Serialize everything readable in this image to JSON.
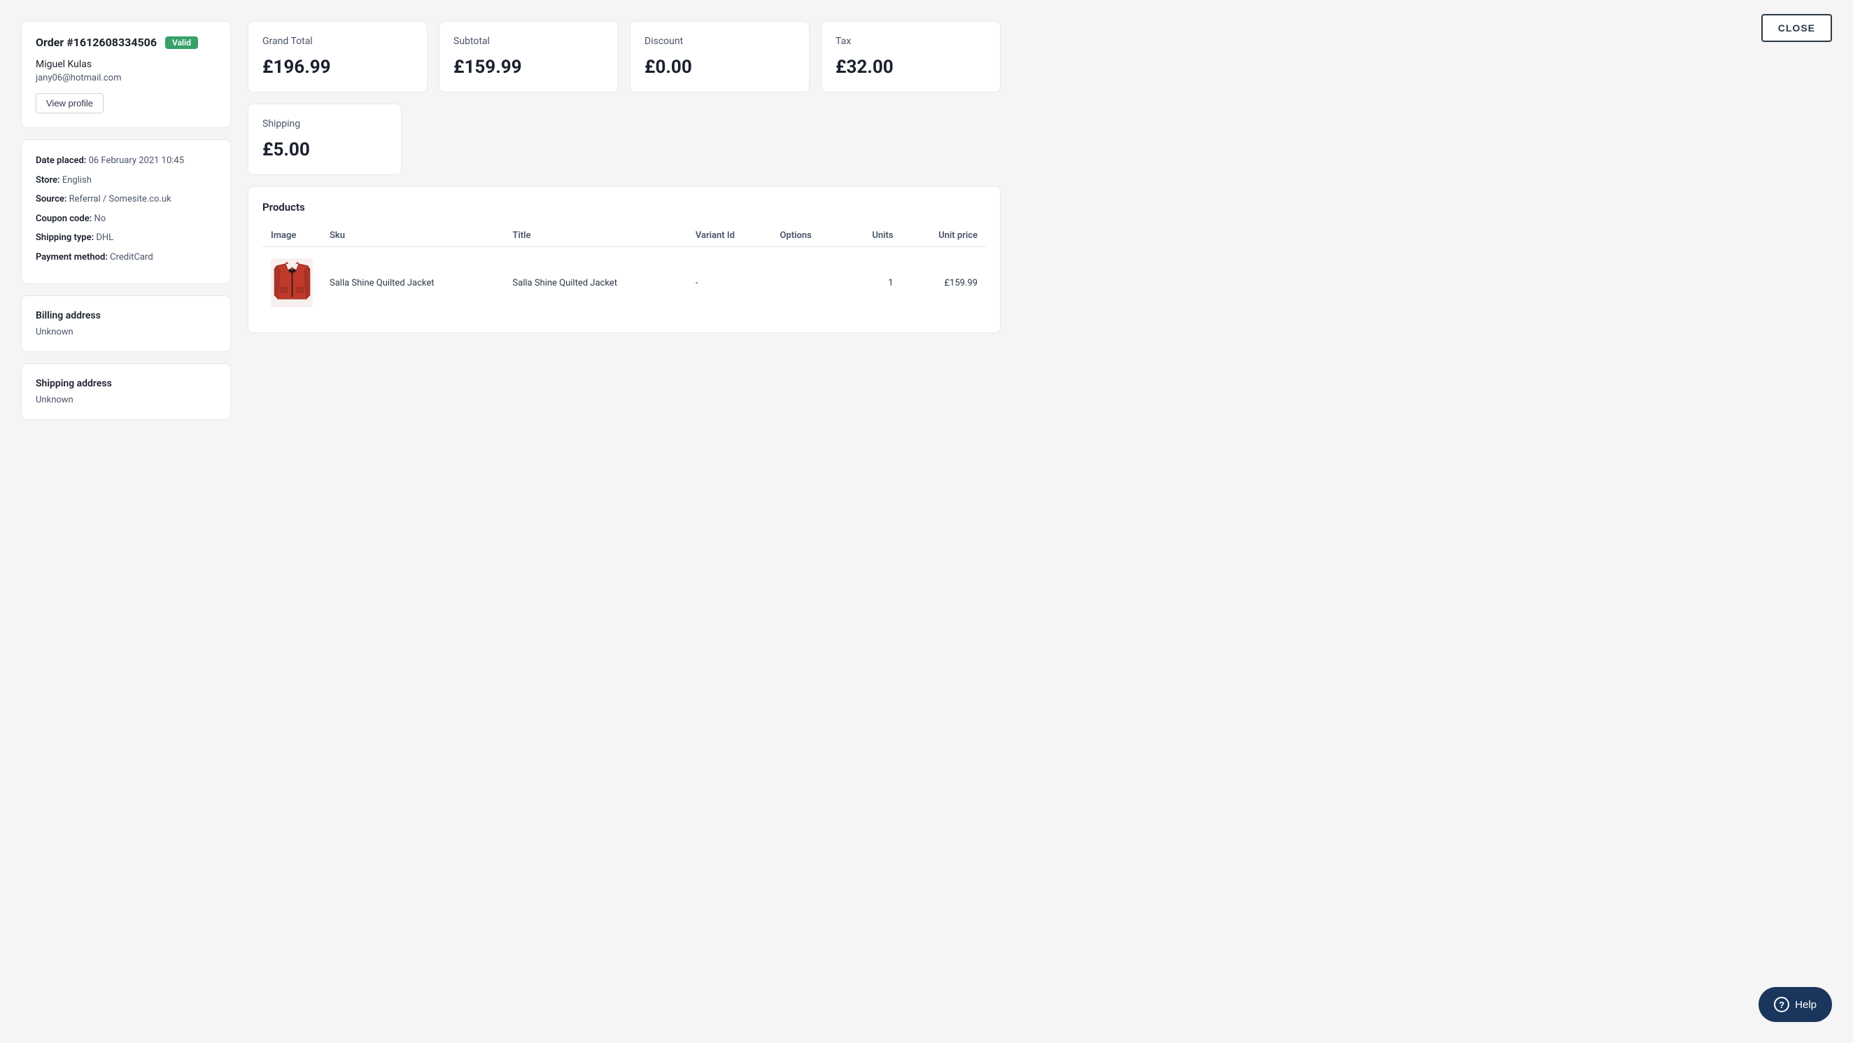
{
  "close_button": {
    "label": "CLOSE"
  },
  "left_col": {
    "order": {
      "title": "Order #1612608334506",
      "badge": "Valid",
      "customer_name": "Miguel Kulas",
      "customer_email": "jany06@hotmail.com",
      "view_profile_label": "View profile"
    },
    "order_details": {
      "date_placed_label": "Date placed:",
      "date_placed_value": "06 February 2021 10:45",
      "store_label": "Store:",
      "store_value": "English",
      "source_label": "Source:",
      "source_value": "Referral / Somesite.co.uk",
      "coupon_label": "Coupon code:",
      "coupon_value": "No",
      "shipping_type_label": "Shipping type:",
      "shipping_type_value": "DHL",
      "payment_label": "Payment method:",
      "payment_value": "CreditCard"
    },
    "billing_address": {
      "title": "Billing address",
      "value": "Unknown"
    },
    "shipping_address": {
      "title": "Shipping address",
      "value": "Unknown"
    }
  },
  "summary": {
    "grand_total_label": "Grand Total",
    "grand_total_value": "£196.99",
    "subtotal_label": "Subtotal",
    "subtotal_value": "£159.99",
    "discount_label": "Discount",
    "discount_value": "£0.00",
    "tax_label": "Tax",
    "tax_value": "£32.00",
    "shipping_label": "Shipping",
    "shipping_value": "£5.00"
  },
  "products": {
    "title": "Products",
    "columns": {
      "image": "Image",
      "sku": "Sku",
      "title": "Title",
      "variant_id": "Variant Id",
      "options": "Options",
      "units": "Units",
      "unit_price": "Unit price"
    },
    "rows": [
      {
        "sku": "Salla Shine Quilted Jacket",
        "title": "Salla Shine Quilted Jacket",
        "variant_id": "-",
        "options": "",
        "units": "1",
        "unit_price": "£159.99"
      }
    ]
  },
  "help_button": {
    "label": "Help"
  }
}
